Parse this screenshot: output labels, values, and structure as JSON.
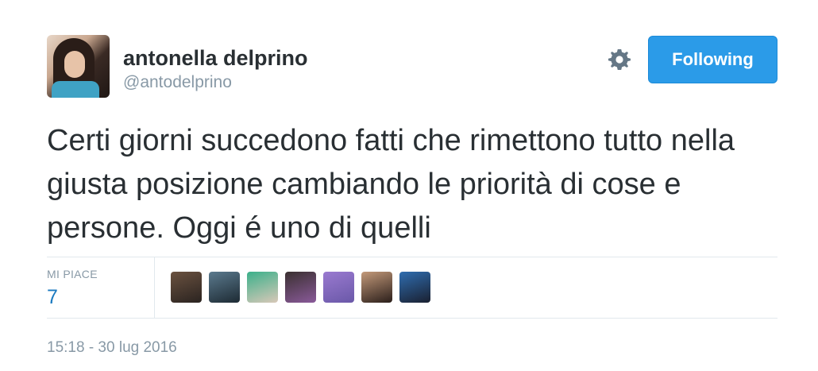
{
  "author": {
    "name": "antonella delprino",
    "handle": "@antodelprino"
  },
  "actions": {
    "follow_label": "Following"
  },
  "tweet": {
    "text": "Certi giorni succedono fatti che rimettono tutto nella giusta posizione cambiando le priorità di cose e persone. Oggi é uno di quelli"
  },
  "stats": {
    "likes_label": "MI PIACE",
    "likes_count": "7"
  },
  "likers": [
    {
      "colors": [
        "#6b5240",
        "#2a2320"
      ]
    },
    {
      "colors": [
        "#5b7a8e",
        "#1d2a33"
      ]
    },
    {
      "colors": [
        "#3bb08a",
        "#d9c8b8"
      ]
    },
    {
      "colors": [
        "#3a3030",
        "#8a5a9a"
      ]
    },
    {
      "colors": [
        "#9a7ad0",
        "#6a58a8"
      ]
    },
    {
      "colors": [
        "#c49a7a",
        "#2a1e1a"
      ]
    },
    {
      "colors": [
        "#2f6db0",
        "#1a2030"
      ]
    }
  ],
  "timestamp": "15:18 - 30 lug 2016",
  "colors": {
    "accent": "#2b9be8",
    "text": "#292f33",
    "muted": "#8899a6",
    "count": "#1b7ac0"
  }
}
